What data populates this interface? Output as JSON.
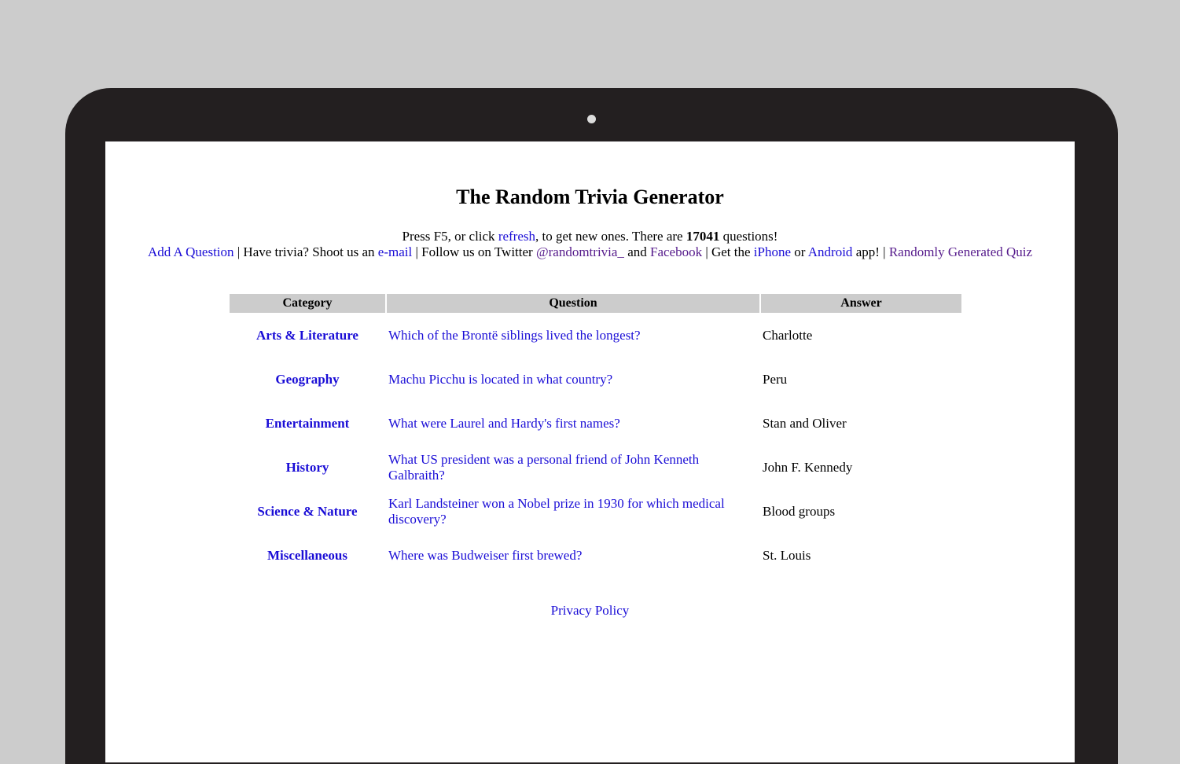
{
  "page": {
    "title": "The Random Trivia Generator"
  },
  "intro": {
    "prefix": "Press F5, or click ",
    "refresh_link": "refresh",
    "middle": ", to get new ones. There are ",
    "count": "17041",
    "suffix": " questions!"
  },
  "links": {
    "add_question": "Add A Question",
    "sep1": " | Have trivia? Shoot us an ",
    "email": "e-mail",
    "sep2": " | Follow us on Twitter ",
    "twitter": "@randomtrivia_",
    "and": " and ",
    "facebook": "Facebook",
    "sep3": " | Get the ",
    "iphone": "iPhone",
    "or": " or ",
    "android": "Android",
    "sep4": " app! | ",
    "random_quiz": "Randomly Generated Quiz"
  },
  "table": {
    "headers": [
      "Category",
      "Question",
      "Answer"
    ],
    "rows": [
      {
        "category": "Arts & Literature",
        "question": "Which of the Brontë siblings lived the longest?",
        "answer": "Charlotte"
      },
      {
        "category": "Geography",
        "question": "Machu Picchu is located in what country?",
        "answer": "Peru"
      },
      {
        "category": "Entertainment",
        "question": "What were Laurel and Hardy's first names?",
        "answer": "Stan and Oliver"
      },
      {
        "category": "History",
        "question": "What US president was a personal friend of John Kenneth Galbraith?",
        "answer": "John F. Kennedy"
      },
      {
        "category": "Science & Nature",
        "question": "Karl Landsteiner won a Nobel prize in 1930 for which medical discovery?",
        "answer": "Blood groups"
      },
      {
        "category": "Miscellaneous",
        "question": "Where was Budweiser first brewed?",
        "answer": "St. Louis"
      }
    ]
  },
  "footer": {
    "privacy": "Privacy Policy"
  },
  "colors": {
    "link": "#1a0dd6",
    "visited_link": "#551a8b",
    "header_bg": "#cccccc",
    "bezel": "#231f20",
    "background": "#cccccc"
  }
}
